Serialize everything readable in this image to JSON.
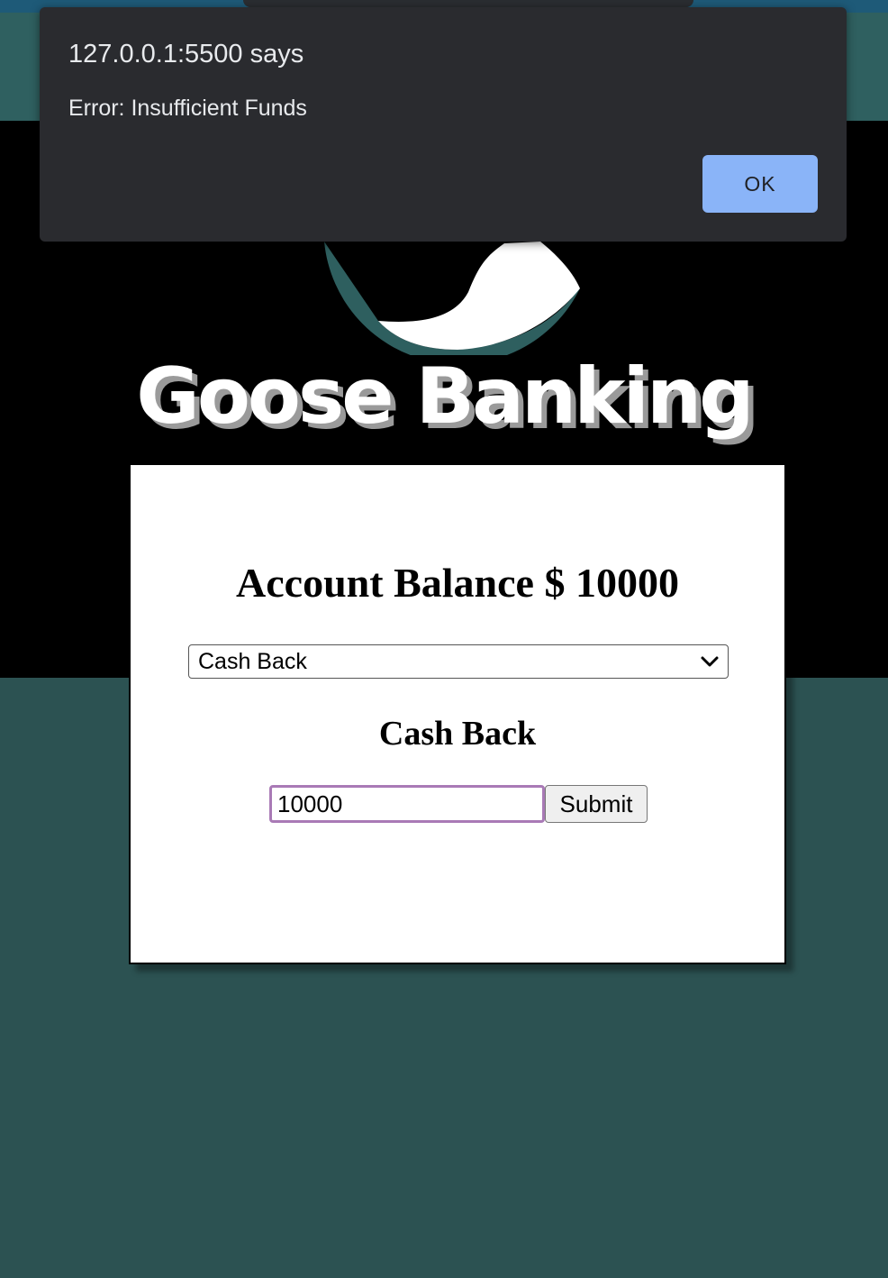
{
  "dialog": {
    "origin": "127.0.0.1:5500 says",
    "message": "Error: Insufficient Funds",
    "ok_label": "OK"
  },
  "header": {
    "brand": "Goose Banking",
    "logo": "goose-logo-icon"
  },
  "account": {
    "balance_label": "Account Balance $ 10000"
  },
  "form": {
    "selected_option": "Cash Back",
    "section_title": "Cash Back",
    "amount_value": "10000",
    "submit_label": "Submit"
  },
  "colors": {
    "background": "#2c5252",
    "hero": "#000000",
    "dialog_bg": "#2a2b2f",
    "ok_button": "#8ab4f8",
    "input_focus_border": "#a97ab6"
  }
}
